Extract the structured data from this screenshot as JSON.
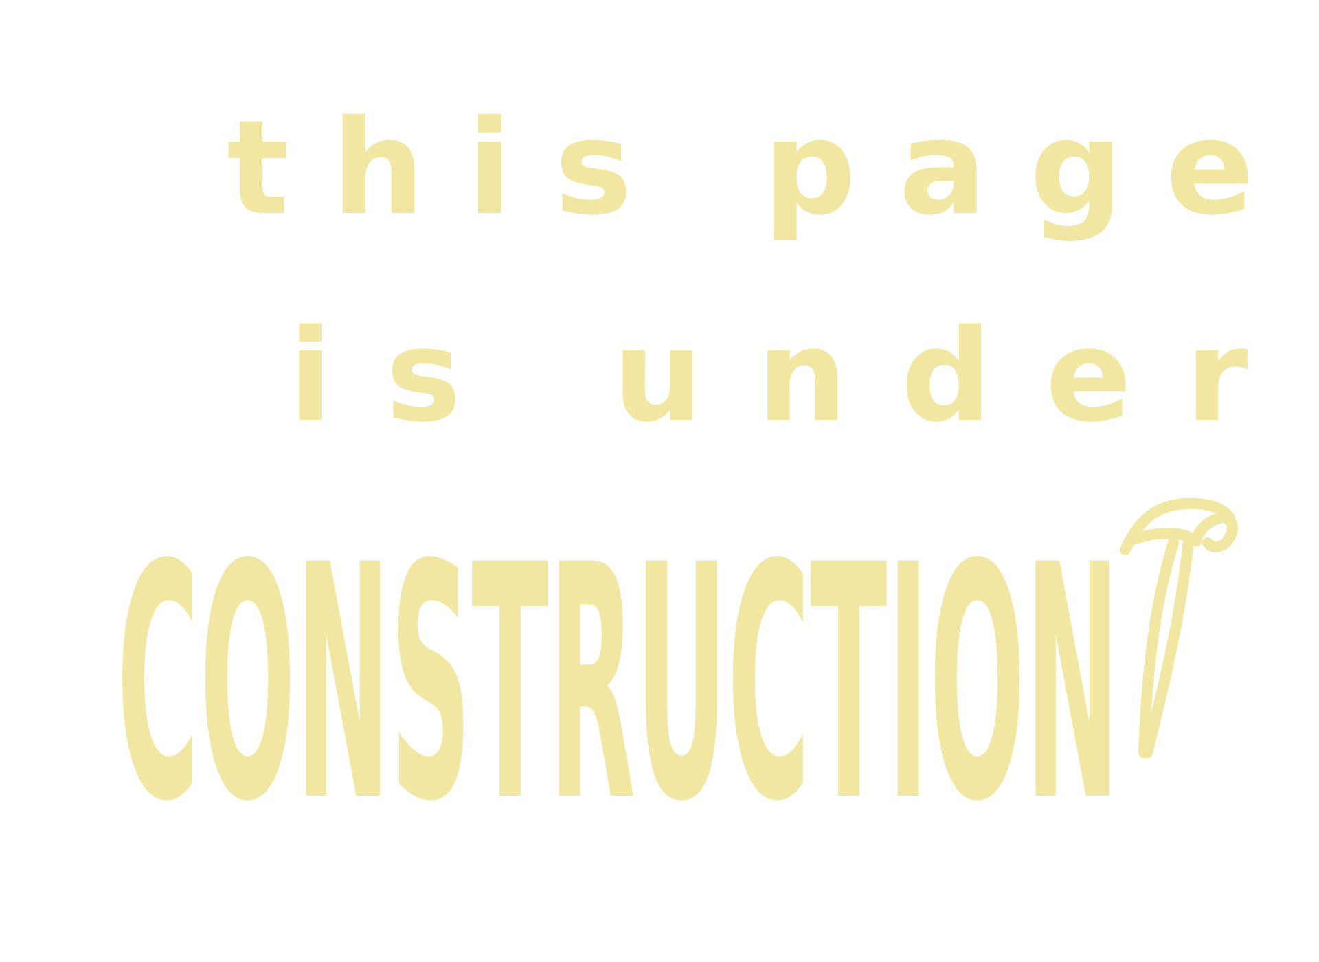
{
  "message": {
    "line1": "this page",
    "line2": "is under",
    "line3": "CONSTRUCTION"
  },
  "colors": {
    "text": "#F1E6A2",
    "background": "#FFFFFF"
  },
  "icons": {
    "pencil": "pencil-icon"
  }
}
